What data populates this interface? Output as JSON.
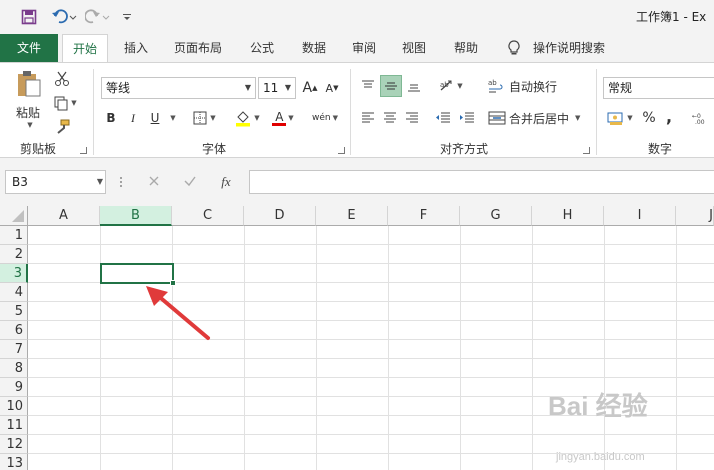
{
  "window": {
    "title": "工作簿1  -  Ex"
  },
  "tabs": [
    {
      "label": "文件"
    },
    {
      "label": "开始"
    },
    {
      "label": "插入"
    },
    {
      "label": "页面布局"
    },
    {
      "label": "公式"
    },
    {
      "label": "数据"
    },
    {
      "label": "审阅"
    },
    {
      "label": "视图"
    },
    {
      "label": "帮助"
    },
    {
      "label": "操作说明搜索"
    }
  ],
  "ribbon": {
    "clipboard": {
      "paste": "粘贴",
      "label": "剪贴板"
    },
    "font": {
      "name": "等线",
      "size": "11",
      "label": "字体",
      "bold": "B",
      "italic": "I",
      "underline": "U",
      "grow": "A",
      "shrink": "A",
      "color_letter": "A",
      "phonetic": "wén"
    },
    "alignment": {
      "wrap": "自动换行",
      "merge": "合并后居中",
      "label": "对齐方式"
    },
    "number": {
      "format": "常规",
      "label": "数字",
      "percent": "%",
      "comma": ","
    }
  },
  "formula_bar": {
    "name_box": "B3",
    "fx": "fx",
    "value": ""
  },
  "grid": {
    "columns": [
      "A",
      "B",
      "C",
      "D",
      "E",
      "F",
      "G",
      "H",
      "I",
      "J"
    ],
    "rows": [
      "1",
      "2",
      "3",
      "4",
      "5",
      "6",
      "7",
      "8",
      "9",
      "10",
      "11",
      "12",
      "13"
    ],
    "selected_cell": "B3"
  },
  "watermark": {
    "brand": "Bai 经验",
    "url": "jingyan.baidu.com"
  },
  "colors": {
    "accent": "#217346",
    "arrow": "#e03a3a"
  }
}
